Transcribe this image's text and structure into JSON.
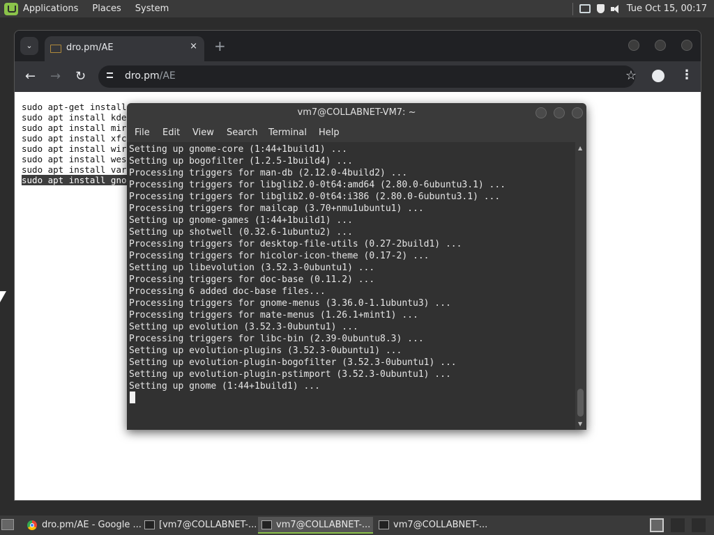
{
  "top_panel": {
    "menus": [
      "Applications",
      "Places",
      "System"
    ],
    "clock": "Tue Oct 15, 00:17"
  },
  "browser": {
    "tab_title": "dro.pm/AE",
    "tab_close": "×",
    "new_tab": "+",
    "url_host": "dro.pm",
    "url_path": "/AE",
    "page_lines": [
      "sudo apt-get install",
      "sudo apt install kde",
      "sudo apt install mir",
      "sudo apt install xfc",
      "sudo apt install wir",
      "sudo apt install wes",
      "sudo apt install var",
      "sudo apt install gno"
    ]
  },
  "terminal": {
    "title": "vm7@COLLABNET-VM7: ~",
    "menu": [
      "File",
      "Edit",
      "View",
      "Search",
      "Terminal",
      "Help"
    ],
    "lines": [
      "Setting up gnome-core (1:44+1build1) ...",
      "Setting up bogofilter (1.2.5-1build4) ...",
      "Processing triggers for man-db (2.12.0-4build2) ...",
      "Processing triggers for libglib2.0-0t64:amd64 (2.80.0-6ubuntu3.1) ...",
      "Processing triggers for libglib2.0-0t64:i386 (2.80.0-6ubuntu3.1) ...",
      "Processing triggers for mailcap (3.70+nmu1ubuntu1) ...",
      "Setting up gnome-games (1:44+1build1) ...",
      "Setting up shotwell (0.32.6-1ubuntu2) ...",
      "Processing triggers for desktop-file-utils (0.27-2build1) ...",
      "Processing triggers for hicolor-icon-theme (0.17-2) ...",
      "Setting up libevolution (3.52.3-0ubuntu1) ...",
      "Processing triggers for doc-base (0.11.2) ...",
      "Processing 6 added doc-base files...",
      "Processing triggers for gnome-menus (3.36.0-1.1ubuntu3) ...",
      "Processing triggers for mate-menus (1.26.1+mint1) ...",
      "Setting up evolution (3.52.3-0ubuntu1) ...",
      "Processing triggers for libc-bin (2.39-0ubuntu8.3) ...",
      "Setting up evolution-plugins (3.52.3-0ubuntu1) ...",
      "Setting up evolution-plugin-bogofilter (3.52.3-0ubuntu1) ...",
      "Setting up evolution-plugin-pstimport (3.52.3-0ubuntu1) ...",
      "Setting up gnome (1:44+1build1) ..."
    ]
  },
  "taskbar": {
    "tasks": [
      {
        "label": "dro.pm/AE - Google ...",
        "icon": "chrome-icon"
      },
      {
        "label": "[vm7@COLLABNET-...",
        "icon": "terminal-icon"
      },
      {
        "label": "vm7@COLLABNET-...",
        "icon": "terminal-icon",
        "active": true
      },
      {
        "label": "vm7@COLLABNET-...",
        "icon": "terminal-icon"
      }
    ]
  }
}
